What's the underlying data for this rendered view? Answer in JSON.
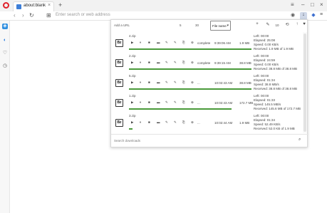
{
  "browser": {
    "tab_title": "about:blank",
    "tab_close": "×",
    "new_tab": "+",
    "address_placeholder": "Enter search or web address",
    "nav": {
      "back": "‹",
      "forward": "›",
      "reload": "↻",
      "speed_dial": "⊞"
    },
    "window_controls": {
      "filter": "≡",
      "minimize": "–",
      "maximize": "□",
      "close": "×"
    },
    "toolbar_icons": {
      "snapshot": "◉",
      "downloads": "↓",
      "extension": "◆",
      "menu": "≡"
    }
  },
  "sidebar": {
    "items": [
      {
        "icon": "opera-icon",
        "glyph": "◈"
      },
      {
        "icon": "messenger-icon",
        "glyph": "◐"
      },
      {
        "icon": "bookmarks-icon",
        "glyph": "♡"
      },
      {
        "icon": "history-icon",
        "glyph": "◷"
      }
    ]
  },
  "downloads_panel": {
    "toolbar": {
      "add_url": "Add a URL",
      "limit_a": "5",
      "limit_b": "30",
      "sort_label": "File name",
      "sort_arrow": "▾",
      "icons": {
        "add": "+",
        "edit": "✎",
        "refresh": "⟲",
        "rotate": "↻",
        "up": "↑",
        "favorite": "♥"
      },
      "counter": "10"
    },
    "items": [
      {
        "name": "4.zip",
        "status": "complete",
        "time": "9:39:06 AM",
        "size": "1.9 MB",
        "info": [
          "Left: 00:00",
          "Elapsed: 25:08",
          "Speed: 0.00 KB/s",
          "Received: 1.9 MB of 1.9 MB"
        ],
        "progress": 1.0,
        "color": "#4a9a3a"
      },
      {
        "name": "2.zip",
        "status": "complete",
        "time": "9:39:15 AM",
        "size": "38.8 MB",
        "info": [
          "Left: 00:00",
          "Elapsed: 24:59",
          "Speed: 0.00 KB/s",
          "Received: 38.8 MB of 38.8 MB"
        ],
        "progress": 1.0,
        "color": "#4a9a3a"
      },
      {
        "name": "5.zip",
        "status": "...",
        "time": "10:02:43 AM",
        "size": "38.8 MB",
        "info": [
          "Left: 00:00",
          "Elapsed: 01:34",
          "Speed: 38.8 MB/s",
          "Received: 38.8 MB of 38.8 MB"
        ],
        "progress": 1.0,
        "color": "#4a9a3a"
      },
      {
        "name": "1.zip",
        "status": "...",
        "time": "10:02:43 AM",
        "size": "172.7 MB",
        "info": [
          "Left: 00:00",
          "Elapsed: 01:33",
          "Speed: 145.5 MB/s",
          "Received: 145.6 MB of 172.7 MB"
        ],
        "progress": 0.84,
        "color": "#4a9a3a"
      },
      {
        "name": "3.zip",
        "status": "...",
        "time": "10:02:44 AM",
        "size": "1.9 MB",
        "info": [
          "Left: 00:00",
          "Elapsed: 01:34",
          "Speed: 52.49 KB/s",
          "Received: 52.0 KB of 1.9 MB"
        ],
        "progress": 0.03,
        "color": "#4a9a3a"
      }
    ],
    "item_controls": [
      "▶",
      "⏸",
      "■",
      "▬",
      "✎",
      "✎",
      "⎘",
      "⊗"
    ],
    "search_placeholder": "Search downloads",
    "search_icon": "⌕"
  }
}
